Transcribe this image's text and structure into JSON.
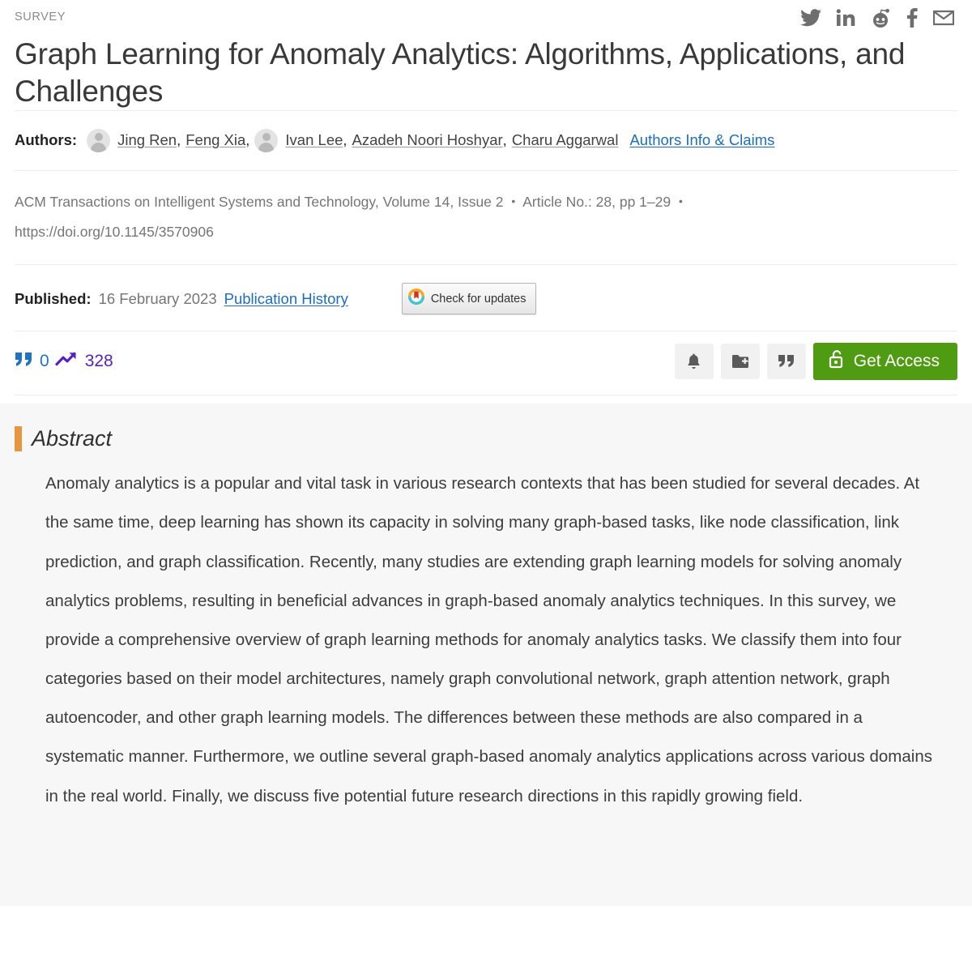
{
  "header": {
    "kicker": "SURVEY",
    "title": "Graph Learning for Anomaly Analytics: Algorithms, Applications, and Challenges",
    "social_icons": [
      {
        "name": "twitter-icon",
        "label": "Twitter"
      },
      {
        "name": "linkedin-icon",
        "label": "in"
      },
      {
        "name": "reddit-icon",
        "label": "Reddit"
      },
      {
        "name": "facebook-icon",
        "label": "f"
      },
      {
        "name": "email-icon",
        "label": "Email"
      }
    ]
  },
  "authors": {
    "label": "Authors:",
    "group_one": [
      "Jing Ren",
      "Feng Xia"
    ],
    "group_two": [
      "Ivan Lee",
      "Azadeh Noori Hoshyar",
      "Charu Aggarwal"
    ],
    "info_link": "Authors Info & Claims"
  },
  "citation": {
    "journal": "ACM Transactions on Intelligent Systems and Technology",
    "volume": "Volume 14",
    "issue": "Issue 2",
    "article_no": "Article No.: 28",
    "pages": "pp 1–29",
    "doi": "https://doi.org/10.1145/3570906",
    "separator_comma": ",",
    "separator_dot": "•"
  },
  "published": {
    "label": "Published:",
    "date": "16 February 2023",
    "history_link": "Publication History",
    "crossmark_label": "Check for updates"
  },
  "metrics": {
    "citations": "0",
    "downloads": "328",
    "citations_color": "#1f72c4",
    "downloads_color": "#5521c4"
  },
  "actions": {
    "alert_label": "Alerts",
    "binder_label": "Save to Binder",
    "cite_label": "Cite",
    "get_access_label": "Get Access",
    "get_access_color": "#4f9c12"
  },
  "abstract": {
    "heading": "Abstract",
    "accent_color": "#e8953f",
    "body": "Anomaly analytics is a popular and vital task in various research contexts that has been studied for several decades. At the same time, deep learning has shown its capacity in solving many graph-based tasks, like node classification, link prediction, and graph classification. Recently, many studies are extending graph learning models for solving anomaly analytics problems, resulting in beneficial advances in graph-based anomaly analytics techniques. In this survey, we provide a comprehensive overview of graph learning methods for anomaly analytics tasks. We classify them into four categories based on their model architectures, namely graph convolutional network, graph attention network, graph autoencoder, and other graph learning models. The differences between these methods are also compared in a systematic manner. Furthermore, we outline several graph-based anomaly analytics applications across various domains in the real world. Finally, we discuss five potential future research directions in this rapidly growing field."
  }
}
